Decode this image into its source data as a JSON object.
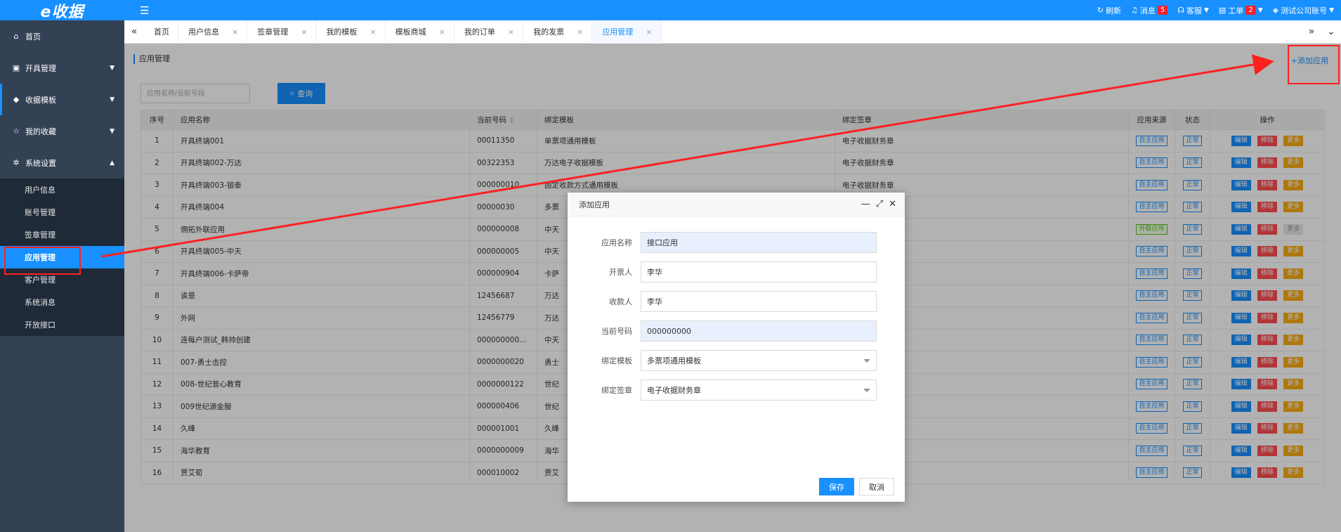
{
  "topbar": {
    "logo": "e收据",
    "refresh": "刷新",
    "messages": "消息",
    "messages_count": "5",
    "service": "客服",
    "tickets": "工单",
    "tickets_count": "2",
    "account": "测试公司账号"
  },
  "sidebar": {
    "home": "首页",
    "groups": [
      {
        "label": "开具管理",
        "icon": "doc-icon"
      },
      {
        "label": "收据模板",
        "icon": "layers-icon"
      },
      {
        "label": "我的收藏",
        "icon": "star-icon"
      },
      {
        "label": "系统设置",
        "icon": "gear-icon"
      }
    ],
    "sub_items": [
      "用户信息",
      "账号管理",
      "签章管理",
      "应用管理",
      "客户管理",
      "系统消息",
      "开放接口"
    ]
  },
  "tabs": [
    "首页",
    "用户信息",
    "签章管理",
    "我的模板",
    "模板商城",
    "我的订单",
    "我的发票",
    "应用管理"
  ],
  "page": {
    "breadcrumb": "应用管理",
    "add_app": "添加应用",
    "search_placeholder": "应用名称/当前号段",
    "search_button": "查询"
  },
  "table": {
    "headers": [
      "序号",
      "应用名称",
      "当前号码",
      "绑定模板",
      "绑定签章",
      "应用来源",
      "状态",
      "操作"
    ],
    "rows": [
      {
        "no": "1",
        "name": "开具终端001",
        "number": "00011350",
        "template": "单票项通用模板",
        "seal": "电子收据财务章",
        "source": "自主应用",
        "status": "正常"
      },
      {
        "no": "2",
        "name": "开具终端002-万达",
        "number": "00322353",
        "template": "万达电子收据模板",
        "seal": "电子收据财务章",
        "source": "自主应用",
        "status": "正常"
      },
      {
        "no": "3",
        "name": "开具终端003-银泰",
        "number": "000000010",
        "template": "固定收款方式通用模板",
        "seal": "电子收据财务章",
        "source": "自主应用",
        "status": "正常"
      },
      {
        "no": "4",
        "name": "开具终端004",
        "number": "00000030",
        "template": "多票",
        "seal": "",
        "source": "自主应用",
        "status": "正常"
      },
      {
        "no": "5",
        "name": "佣拓外联应用",
        "number": "000000008",
        "template": "中天",
        "seal": "",
        "source": "外联应用",
        "status": "正常"
      },
      {
        "no": "6",
        "name": "开具终端005-中天",
        "number": "000000005",
        "template": "中天",
        "seal": "",
        "source": "自主应用",
        "status": "正常"
      },
      {
        "no": "7",
        "name": "开具终端006-卡萨帝",
        "number": "000000904",
        "template": "卡萨",
        "seal": "",
        "source": "自主应用",
        "status": "正常"
      },
      {
        "no": "8",
        "name": "诶是",
        "number": "12456687",
        "template": "万达",
        "seal": "",
        "source": "自主应用",
        "status": "正常"
      },
      {
        "no": "9",
        "name": "外网",
        "number": "12456779",
        "template": "万达",
        "seal": "",
        "source": "自主应用",
        "status": "正常"
      },
      {
        "no": "10",
        "name": "连每户测试_韩帅创建",
        "number": "000000000...",
        "template": "中天",
        "seal": "",
        "source": "自主应用",
        "status": "正常"
      },
      {
        "no": "11",
        "name": "007-勇士击控",
        "number": "0000000020",
        "template": "勇士",
        "seal": "",
        "source": "自主应用",
        "status": "正常"
      },
      {
        "no": "12",
        "name": "008-世纪普心教育",
        "number": "0000000122",
        "template": "世纪",
        "seal": "",
        "source": "自主应用",
        "status": "正常"
      },
      {
        "no": "13",
        "name": "009世纪源金服",
        "number": "000000406",
        "template": "世纪",
        "seal": "",
        "source": "自主应用",
        "status": "正常"
      },
      {
        "no": "14",
        "name": "久峰",
        "number": "000001001",
        "template": "久峰",
        "seal": "",
        "source": "自主应用",
        "status": "正常"
      },
      {
        "no": "15",
        "name": "海华教育",
        "number": "0000000009",
        "template": "海华",
        "seal": "",
        "source": "自主应用",
        "status": "正常"
      },
      {
        "no": "16",
        "name": "贾艾荀",
        "number": "000010002",
        "template": "贾艾",
        "seal": "",
        "source": "自主应用",
        "status": "正常"
      }
    ],
    "ops": {
      "edit": "编辑",
      "remove": "移除",
      "more": "更多"
    }
  },
  "modal": {
    "title": "添加应用",
    "fields": [
      {
        "label": "应用名称",
        "value": "接口应用"
      },
      {
        "label": "开票人",
        "value": "李华"
      },
      {
        "label": "收款人",
        "value": "李华"
      },
      {
        "label": "当前号码",
        "value": "000000000"
      },
      {
        "label": "绑定模板",
        "value": "多票项通用模板"
      },
      {
        "label": "绑定签章",
        "value": "电子收据财务章"
      }
    ],
    "save": "保存",
    "cancel": "取消"
  },
  "colors": {
    "primary": "#1890ff",
    "sidebar": "#334155",
    "annotation": "#ff2020"
  }
}
